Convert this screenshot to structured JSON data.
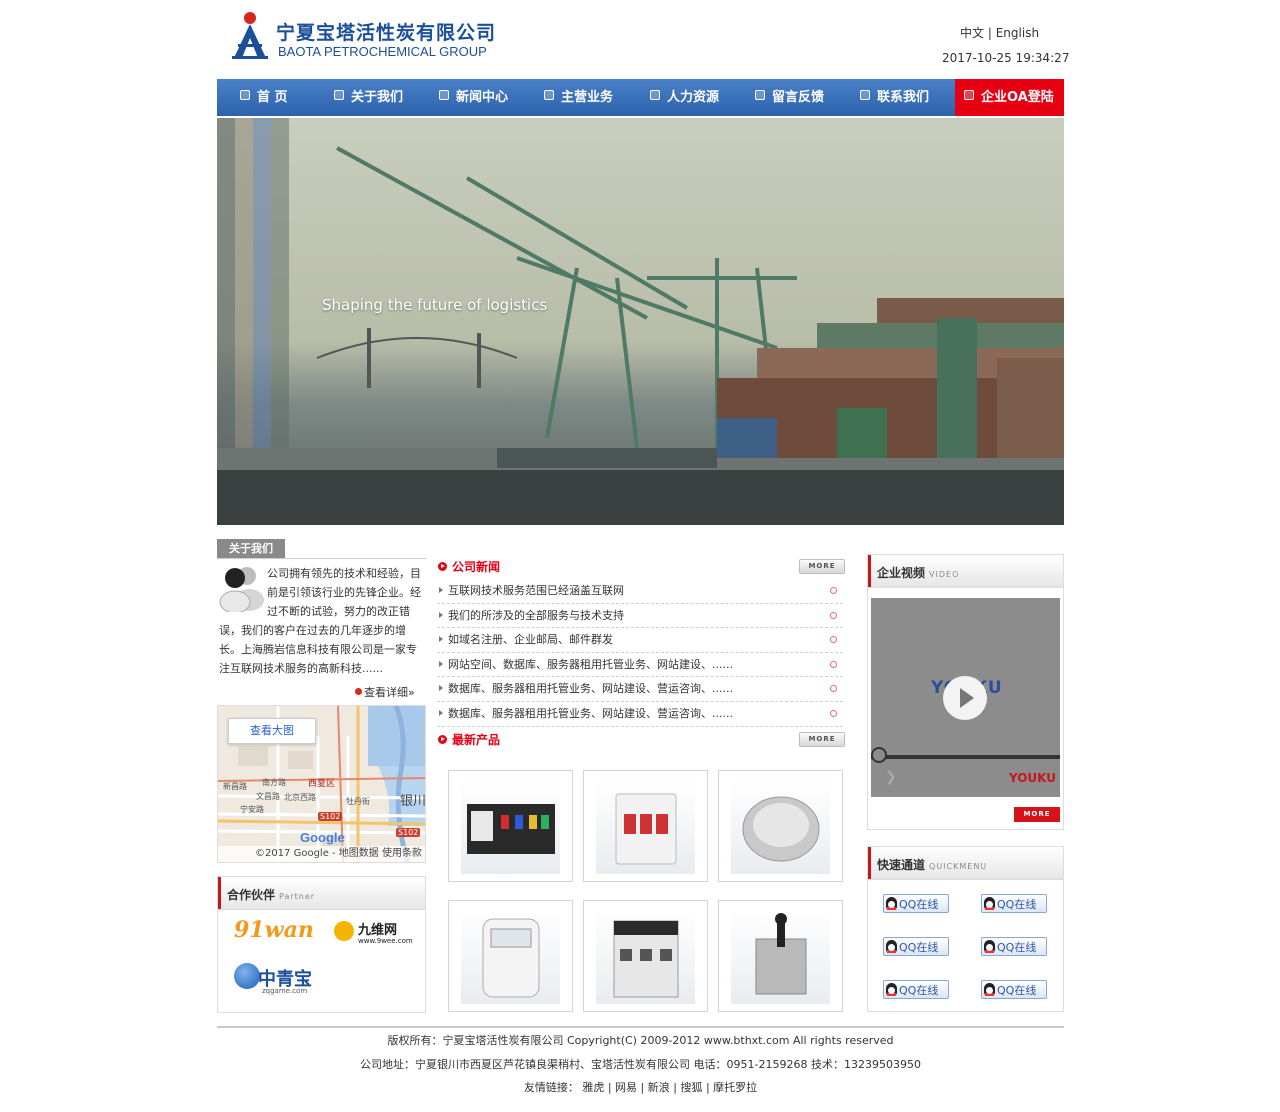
{
  "header": {
    "logo_cn": "宁夏宝塔活性炭有限公司",
    "logo_en": "BAOTA PETROCHEMICAL GROUP",
    "lang_cn": "中文",
    "lang_sep": "|",
    "lang_en": "English",
    "datetime": "2017-10-25 19:34:27"
  },
  "nav": {
    "items": [
      "首 页",
      "关于我们",
      "新闻中心",
      "主营业务",
      "人力资源",
      "留言反馈",
      "联系我们"
    ],
    "oa": "企业OA登陆"
  },
  "banner": {
    "slogan": "Shaping the future of logistics"
  },
  "about": {
    "title": "关于我们",
    "text": "公司拥有领先的技术和经验，目前是引领该行业的先锋企业。经过不断的试验，努力的改正错误，我们的客户在过去的几年逐步的增长。上海腾岩信息科技有限公司是一家专注互联网技术服务的高新科技......",
    "more": "查看详细"
  },
  "map": {
    "view_large": "查看大图",
    "labels": {
      "xixia": "西夏区",
      "yinchuan": "银川",
      "nanfang": "南方路",
      "wenchang": "文昌路",
      "beijingxi": "北京西路",
      "ningan": "宁安路",
      "xinchang": "新昌路",
      "mudan": "牡丹街",
      "s102a": "S102",
      "s102b": "S102"
    },
    "google": "Google",
    "copyright": "©2017 Google - 地图数据   使用条款"
  },
  "partners": {
    "title": "合作伙伴",
    "sub": "Partner",
    "logo_91wan_a": "91",
    "logo_91wan_b": "wan",
    "logo_9wee": "九维网",
    "logo_9wee_url": "www.9wee.com",
    "logo_zq": "中青宝",
    "logo_zq_url": "zqgame.com"
  },
  "company_news": {
    "title": "公司新闻",
    "more": "MORE",
    "items": [
      "互联网技术服务范围已经涵盖互联网",
      "我们的所涉及的全部服务与技术支持",
      "如域名注册、企业邮局、邮件群发",
      "网站空间、数据库、服务器租用托管业务、网站建设、......",
      "数据库、服务器租用托管业务、网站建设、营运咨询、......",
      "数据库、服务器租用托管业务、网站建设、营运咨询、......"
    ]
  },
  "new_products": {
    "title": "最新产品",
    "more": "MORE"
  },
  "video": {
    "title": "企业视频",
    "sub": "VIDEO",
    "brand": "YOUKU",
    "more": "MORE",
    "progress": 0
  },
  "quick": {
    "title": "快速通道",
    "sub": "QUICKMENU",
    "qq_label": "QQ在线"
  },
  "footer": {
    "line1": "版权所有：宁夏宝塔活性炭有限公司 Copyright(C) 2009-2012 www.bthxt.com All rights reserved",
    "line2": "公司地址：宁夏银川市西夏区芦花镇良渠稍村、宝塔活性炭有限公司 电话：0951-2159268 技术：13239503950",
    "links_label": "友情链接：",
    "links": [
      "雅虎",
      "网易",
      "新浪",
      "搜狐",
      "摩托罗拉"
    ]
  },
  "colors": {
    "nav_blue": "#2d63ad",
    "accent_red": "#e60012",
    "logo_blue": "#1c4f9a"
  }
}
